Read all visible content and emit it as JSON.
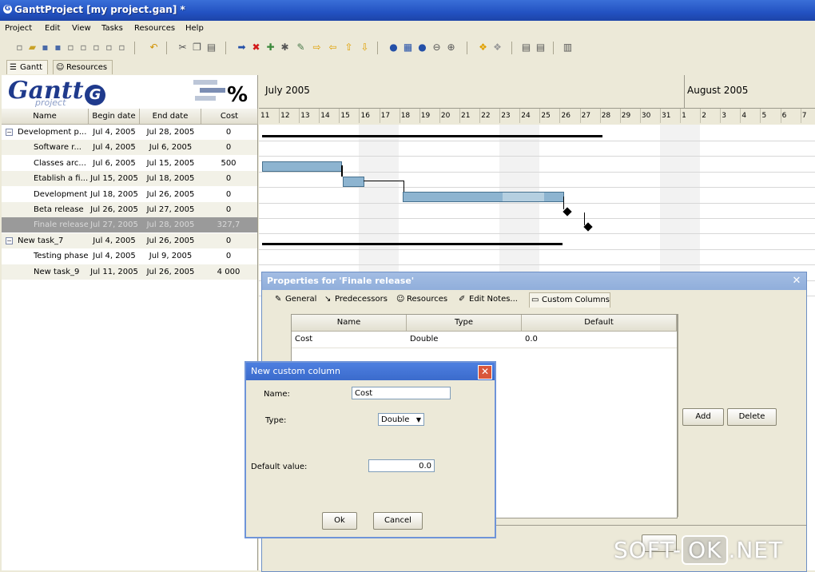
{
  "window": {
    "title": "GanttProject [my project.gan] *"
  },
  "menu": [
    "Project",
    "Edit",
    "View",
    "Tasks",
    "Resources",
    "Help"
  ],
  "tabs": [
    {
      "label": "Gantt",
      "icon": "gantt-icon"
    },
    {
      "label": "Resources",
      "icon": "resources-icon"
    }
  ],
  "logo": {
    "text": "Gantt",
    "sub": "project",
    "badge": "G",
    "percent": "%"
  },
  "table": {
    "headers": [
      "Name",
      "Begin date",
      "End date",
      "Cost"
    ],
    "rows": [
      {
        "name": "Development p...",
        "begin": "Jul 4, 2005",
        "end": "Jul 28, 2005",
        "cost": "0",
        "level": 0,
        "expander": "−"
      },
      {
        "name": "Software r...",
        "begin": "Jul 4, 2005",
        "end": "Jul 6, 2005",
        "cost": "0",
        "level": 1
      },
      {
        "name": "Classes arc...",
        "begin": "Jul 6, 2005",
        "end": "Jul 15, 2005",
        "cost": "500",
        "level": 1
      },
      {
        "name": "Etablish a fi...",
        "begin": "Jul 15, 2005",
        "end": "Jul 18, 2005",
        "cost": "0",
        "level": 1
      },
      {
        "name": "Development",
        "begin": "Jul 18, 2005",
        "end": "Jul 26, 2005",
        "cost": "0",
        "level": 1
      },
      {
        "name": "Beta release",
        "begin": "Jul 26, 2005",
        "end": "Jul 27, 2005",
        "cost": "0",
        "level": 1
      },
      {
        "name": "Finale release",
        "begin": "Jul 27, 2005",
        "end": "Jul 28, 2005",
        "cost": "327,7",
        "level": 1,
        "selected": true
      },
      {
        "name": "New task_7",
        "begin": "Jul 4, 2005",
        "end": "Jul 26, 2005",
        "cost": "0",
        "level": 0,
        "expander": "−"
      },
      {
        "name": "Testing phase",
        "begin": "Jul 4, 2005",
        "end": "Jul 9, 2005",
        "cost": "0",
        "level": 1
      },
      {
        "name": "New task_9",
        "begin": "Jul 11, 2005",
        "end": "Jul 26, 2005",
        "cost": "4 000",
        "level": 1
      }
    ]
  },
  "timeline": {
    "months": [
      "July 2005",
      "August 2005"
    ],
    "days": [
      "11",
      "12",
      "13",
      "14",
      "15",
      "16",
      "17",
      "18",
      "19",
      "20",
      "21",
      "22",
      "23",
      "24",
      "25",
      "26",
      "27",
      "28",
      "29",
      "30",
      "31",
      "1",
      "2",
      "3",
      "4",
      "5",
      "6",
      "7"
    ]
  },
  "properties_dialog": {
    "title": "Properties for 'Finale release'",
    "tabs": [
      {
        "label": "General",
        "icon": "general-icon"
      },
      {
        "label": "Predecessors",
        "icon": "predecessors-icon"
      },
      {
        "label": "Resources",
        "icon": "resources-icon"
      },
      {
        "label": "Edit Notes...",
        "icon": "notes-icon"
      },
      {
        "label": "Custom Columns",
        "icon": "columns-icon"
      }
    ],
    "columns": [
      "Name",
      "Type",
      "Default"
    ],
    "rows": [
      {
        "name": "Cost",
        "type": "Double",
        "default": "0.0"
      }
    ],
    "add_label": "Add",
    "delete_label": "Delete"
  },
  "new_column_dialog": {
    "title": "New custom column",
    "name_label": "Name:",
    "name_value": "Cost",
    "type_label": "Type:",
    "type_value": "Double",
    "default_label": "Default value:",
    "default_value": "0.0",
    "ok_label": "Ok",
    "cancel_label": "Cancel"
  },
  "watermark": {
    "left": "SOFT-",
    "box": "OK",
    "right": ".NET"
  },
  "colors": {
    "titlebar": "#2352c2",
    "task_bar": "#8db4d0",
    "selection": "#9a9a9a"
  }
}
